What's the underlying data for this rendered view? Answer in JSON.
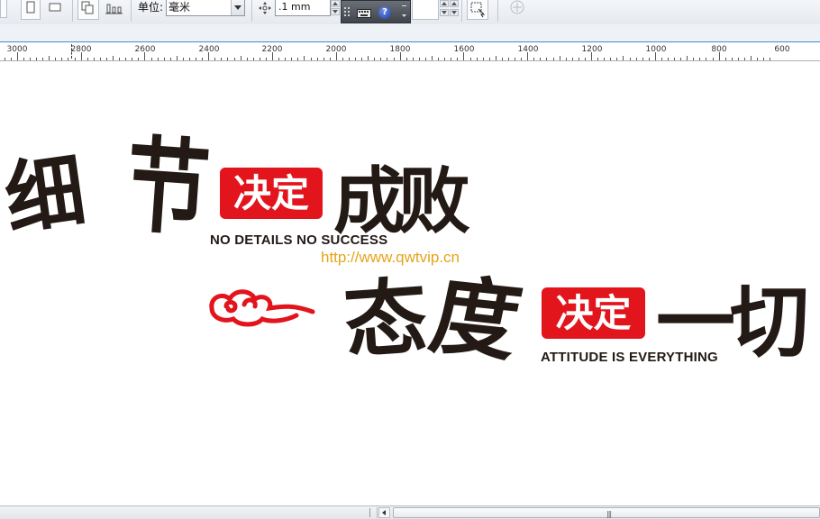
{
  "toolbar": {
    "units_label": "单位:",
    "units_value": "毫米",
    "nudge_value": ".1 mm",
    "help_glyph": "?"
  },
  "ruler": {
    "labels": [
      "3000",
      "2800",
      "2600",
      "2400",
      "2200",
      "2000",
      "1800",
      "1600",
      "1400",
      "1200",
      "1000",
      "800",
      "600"
    ]
  },
  "artwork": {
    "line1_brush": [
      "细",
      "节"
    ],
    "line1_badge": "决定",
    "line1_tail": "成败",
    "line1_english": "NO DETAILS NO SUCCESS",
    "watermark_url": "http://www.qwtvip.cn",
    "line2_brush": [
      "态",
      "度"
    ],
    "line2_badge": "决定",
    "line2_tail": "一切",
    "line2_english": "ATTITUDE IS EVERYTHING"
  },
  "colors": {
    "brand_red": "#e2141c",
    "ink": "#231a16",
    "url_orange": "#e6a419",
    "ruler_accent": "#3b8fd6"
  },
  "icons": [
    "portrait-icon",
    "landscape-icon",
    "copy-page-icon",
    "align-icon",
    "nudge-icon",
    "keyboard-icon",
    "help-icon",
    "object-frame-icon",
    "add-icon"
  ]
}
